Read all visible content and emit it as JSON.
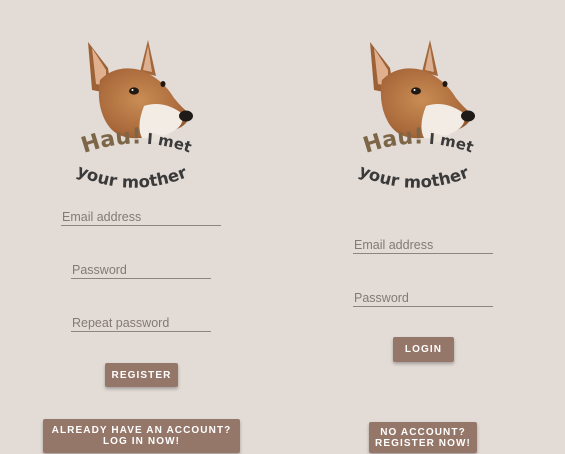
{
  "register_screen": {
    "logo": {
      "line1_bold": "Hau!",
      "line1_rest": "I met",
      "line2": "your mother"
    },
    "email_placeholder": "Email address",
    "password_placeholder": "Password",
    "repeat_password_placeholder": "Repeat password",
    "register_button": "REGISTER",
    "login_link_line1": "ALREADY HAVE AN ACCOUNT?",
    "login_link_line2": "LOG IN NOW!"
  },
  "login_screen": {
    "logo": {
      "line1_bold": "Hau!",
      "line1_rest": "I met",
      "line2": "your mother"
    },
    "email_placeholder": "Email address",
    "password_placeholder": "Password",
    "login_button": "LOGIN",
    "register_link_line1": "NO ACCOUNT?",
    "register_link_line2": "REGISTER NOW!"
  },
  "colors": {
    "background": "#e3dbd6",
    "button": "#95776a",
    "logo_text_brown": "#7d6648",
    "logo_text_dark": "#3a3a3a"
  },
  "icons": [
    "dog-logo-icon"
  ]
}
